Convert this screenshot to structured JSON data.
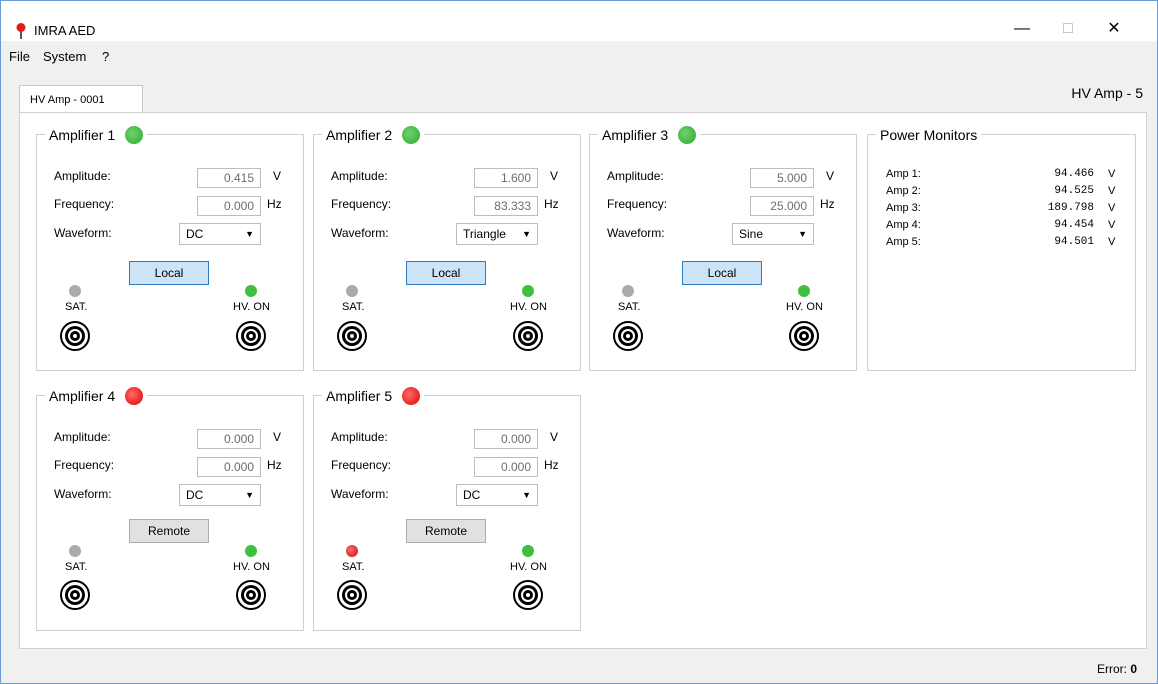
{
  "window": {
    "title": "IMRA AED",
    "minimize": "—",
    "maximize": "□",
    "close": "✕"
  },
  "menu": [
    "File",
    "System",
    "?"
  ],
  "tab": {
    "label": "HV Amp - 0001"
  },
  "device_title": "HV Amp - 5",
  "labels": {
    "amplitude": "Amplitude:",
    "frequency": "Frequency:",
    "waveform": "Waveform:",
    "sat": "SAT.",
    "hvon": "HV. ON"
  },
  "amplifiers": [
    {
      "title": "Amplifier 1",
      "status": "green",
      "amplitude": "0.415",
      "amp_unit": "V",
      "frequency": "0.000",
      "freq_unit": "Hz",
      "waveform": "DC",
      "button": "Local",
      "sat": "off",
      "hv_on": "on"
    },
    {
      "title": "Amplifier 2",
      "status": "green",
      "amplitude": "1.600",
      "amp_unit": "V",
      "frequency": "83.333",
      "freq_unit": "Hz",
      "waveform": "Triangle",
      "button": "Local",
      "sat": "off",
      "hv_on": "on"
    },
    {
      "title": "Amplifier 3",
      "status": "green",
      "amplitude": "5.000",
      "amp_unit": "V",
      "frequency": "25.000",
      "freq_unit": "Hz",
      "waveform": "Sine",
      "button": "Local",
      "sat": "off",
      "hv_on": "on"
    },
    {
      "title": "Amplifier 4",
      "status": "red",
      "amplitude": "0.000",
      "amp_unit": "V",
      "frequency": "0.000",
      "freq_unit": "Hz",
      "waveform": "DC",
      "button": "Remote",
      "sat": "off",
      "hv_on": "on"
    },
    {
      "title": "Amplifier 5",
      "status": "red",
      "amplitude": "0.000",
      "amp_unit": "V",
      "frequency": "0.000",
      "freq_unit": "Hz",
      "waveform": "DC",
      "button": "Remote",
      "sat": "red",
      "hv_on": "on"
    }
  ],
  "power_monitors": {
    "title": "Power Monitors",
    "rows": [
      {
        "label": "Amp 1:",
        "value": "94.466",
        "unit": "V"
      },
      {
        "label": "Amp 2:",
        "value": "94.525",
        "unit": "V"
      },
      {
        "label": "Amp 3:",
        "value": "189.798",
        "unit": "V"
      },
      {
        "label": "Amp 4:",
        "value": "94.454",
        "unit": "V"
      },
      {
        "label": "Amp 5:",
        "value": "94.501",
        "unit": "V"
      }
    ]
  },
  "status": {
    "error_label": "Error:",
    "error_count": "0"
  },
  "colors": {
    "led_green": "#3fbf3f",
    "led_red": "#e00000",
    "local_button": "#cce4f7",
    "remote_button": "#e1e1e1"
  }
}
